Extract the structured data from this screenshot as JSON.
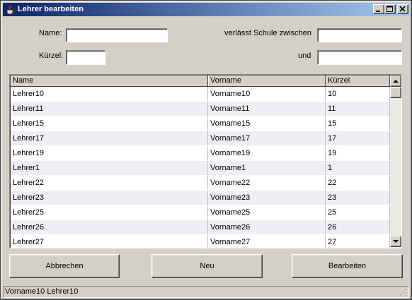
{
  "window": {
    "title": "Lehrer bearbeiten",
    "app_icon": "java-cup-icon"
  },
  "form": {
    "name_label": "Name:",
    "name_value": "",
    "kuerzel_label": "Kürzel:",
    "kuerzel_value": "",
    "leaves_label": "verlässt Schule zwischen",
    "leaves_from_value": "",
    "and_label": "und",
    "leaves_to_value": ""
  },
  "table": {
    "columns": [
      "Name",
      "Vorname",
      "Kürzel"
    ],
    "rows": [
      [
        "Lehrer10",
        "Vorname10",
        "10"
      ],
      [
        "Lehrer11",
        "Vorname11",
        "11"
      ],
      [
        "Lehrer15",
        "Vorname15",
        "15"
      ],
      [
        "Lehrer17",
        "Vorname17",
        "17"
      ],
      [
        "Lehrer19",
        "Vorname19",
        "19"
      ],
      [
        "Lehrer1",
        "Vorname1",
        "1"
      ],
      [
        "Lehrer22",
        "Vorname22",
        "22"
      ],
      [
        "Lehrer23",
        "Vorname23",
        "23"
      ],
      [
        "Lehrer25",
        "Vorname25",
        "25"
      ],
      [
        "Lehrer26",
        "Vorname26",
        "26"
      ],
      [
        "Lehrer27",
        "Vorname27",
        "27"
      ]
    ]
  },
  "buttons": {
    "cancel": "Abbrechen",
    "new": "Neu",
    "edit": "Bearbeiten"
  },
  "status": {
    "text": "Vorname10 Lehrer10"
  },
  "colors": {
    "title_start": "#0a246a",
    "title_end": "#a6caf0",
    "face": "#d4d0c8",
    "row_alt": "#eeeef4"
  }
}
